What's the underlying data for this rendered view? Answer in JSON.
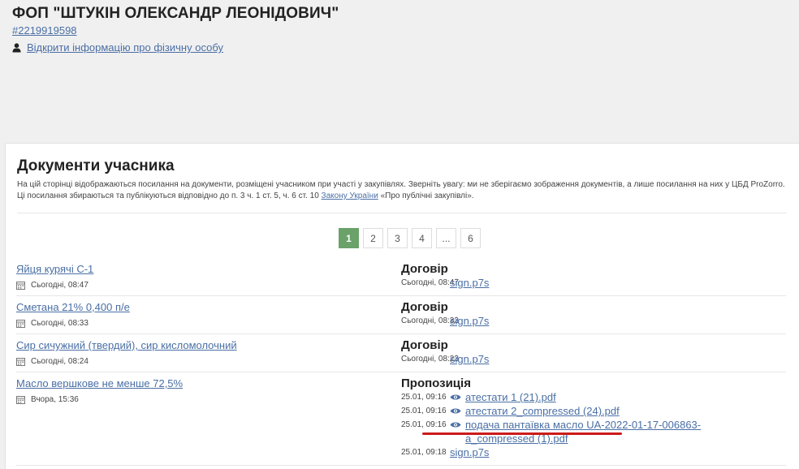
{
  "header": {
    "title": "ФОП \"ШТУКІН ОЛЕКСАНДР ЛЕОНІДОВИЧ\"",
    "code": "#2219919598",
    "person_link": "Відкрити інформацію про фізичну особу"
  },
  "docs": {
    "title": "Документи учасника",
    "desc_before": "На цій сторінці відображаються посилання на документи, розміщені учасником при участі у закупівлях. Зверніть увагу: ми не зберігаємо зображення документів, а лише посилання на них у ЦБД ProZorro. Ці посилання збираються та публікуються відповідно до п. 3 ч. 1 ст. 5, ч. 6 ст. 10 ",
    "desc_link": "Закону України",
    "desc_after": " «Про публічні закупівлі».",
    "pagination": [
      "1",
      "2",
      "3",
      "4",
      "...",
      "6"
    ],
    "rows": [
      {
        "item": "Яйця курячі С-1",
        "date": "Сьогодні, 08:47",
        "type": "Договір",
        "files": [
          {
            "time": "Сьогодні, 08:47",
            "name": "sign.p7s"
          }
        ]
      },
      {
        "item": "Сметана 21% 0,400 п/е",
        "date": "Сьогодні, 08:33",
        "type": "Договір",
        "files": [
          {
            "time": "Сьогодні, 08:33",
            "name": "sign.p7s"
          }
        ]
      },
      {
        "item": "Сир сичужний (твердий), сир кисломолочний",
        "date": "Сьогодні, 08:24",
        "type": "Договір",
        "files": [
          {
            "time": "Сьогодні, 08:23",
            "name": "sign.p7s"
          }
        ]
      },
      {
        "item": "Масло вершкове не менше 72,5%",
        "date": "Вчора, 15:36",
        "type": "Пропозиція",
        "files": [
          {
            "time": "25.01, 09:16",
            "name": "атестати 1 (21).pdf"
          },
          {
            "time": "25.01, 09:16",
            "name": "атестати 2_compressed (24).pdf"
          },
          {
            "time": "25.01, 09:16",
            "name": "подача пантаївка масло UA-2022-01-17-006863-a_compressed (1).pdf"
          },
          {
            "time": "25.01, 09:18",
            "name": "sign.p7s"
          }
        ]
      }
    ]
  },
  "colors": {
    "accent": "#6aa26a",
    "link": "#4a6fa5",
    "highlight": "#cc1a1a"
  }
}
